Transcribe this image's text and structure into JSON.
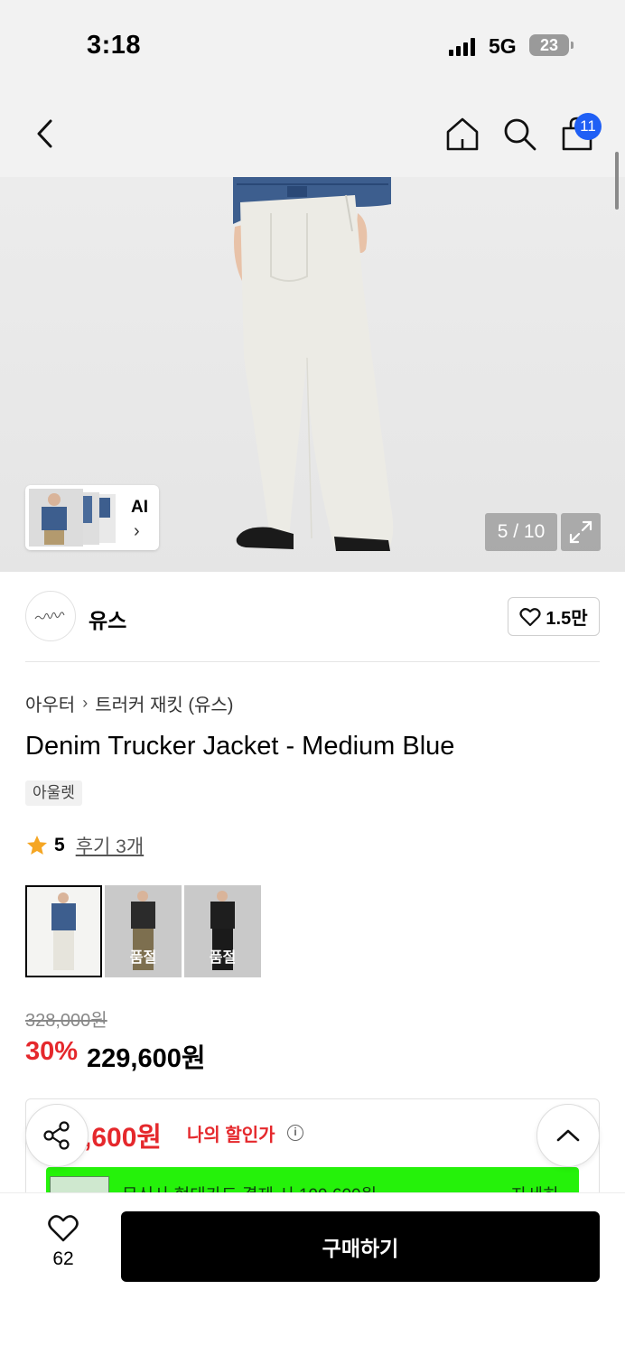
{
  "status_bar": {
    "time": "3:18",
    "network": "5G",
    "battery": "23"
  },
  "nav": {
    "cart_count": "11",
    "icons": [
      "chevron-left-icon",
      "home-icon",
      "search-icon",
      "shopping-bag-icon"
    ]
  },
  "gallery": {
    "ai_label": "AI",
    "counter": "5 / 10"
  },
  "brand": {
    "name": "유스",
    "likes": "1.5만"
  },
  "breadcrumb": {
    "category": "아우터",
    "subcategory": "트러커 재킷 (유스)"
  },
  "product": {
    "title": "Denim Trucker Jacket - Medium Blue",
    "tag": "아울렛",
    "rating": "5",
    "reviews": "후기 3개",
    "options": [
      {
        "soldout": ""
      },
      {
        "soldout": "품절"
      },
      {
        "soldout": "품절"
      }
    ],
    "original_price": "328,000원",
    "discount_pct": "30%",
    "sale_price": "229,600원"
  },
  "my_discount": {
    "price": ",600원",
    "label": "나의 할인가",
    "banner_text": "무신사 현대카드 결제 시 199,600원",
    "banner_link": "자세히"
  },
  "bottom": {
    "wish_count": "62",
    "buy_label": "구매하기"
  },
  "colors": {
    "accent_red": "#e5282c",
    "badge_blue": "#1f5ff5",
    "promo_green": "#25f20a"
  }
}
